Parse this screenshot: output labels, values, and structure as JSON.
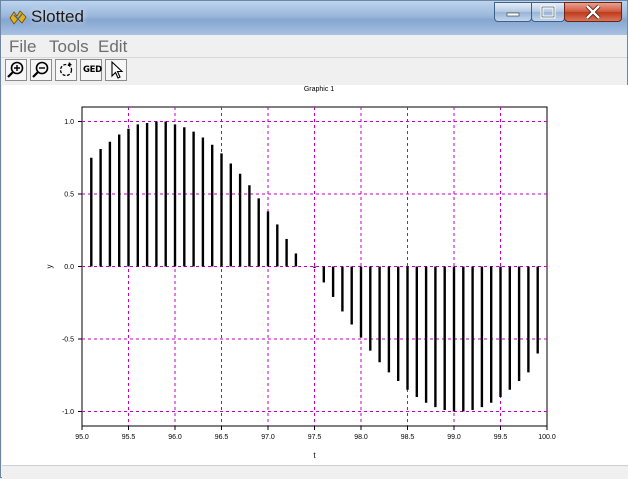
{
  "window": {
    "title": "Slotted",
    "controls": [
      "minimize",
      "maximize",
      "close"
    ],
    "icon": "scilab-icon"
  },
  "menu": [
    "File",
    "Tools",
    "Edit"
  ],
  "toolbar": {
    "buttons": [
      {
        "name": "zoom-in",
        "icon": "zoom-in-icon"
      },
      {
        "name": "zoom-out",
        "icon": "zoom-out-icon"
      },
      {
        "name": "rotate",
        "icon": "rotate-icon"
      },
      {
        "name": "ged",
        "label": "GED"
      },
      {
        "name": "pointer",
        "icon": "pointer-icon"
      }
    ]
  },
  "chart_data": {
    "type": "bar",
    "style": "stem",
    "title": "Graphic 1",
    "xlabel": "t",
    "ylabel": "y",
    "xlim": [
      95.0,
      100.0
    ],
    "ylim": [
      -1.1,
      1.1
    ],
    "xticks": [
      "95.0",
      "95.5",
      "96.0",
      "96.5",
      "97.0",
      "97.5",
      "98.0",
      "98.5",
      "99.0",
      "99.5",
      "100.0"
    ],
    "yticks": [
      "-1.0",
      "-0.5",
      "0.0",
      "0.5",
      "1.0"
    ],
    "grid": true,
    "grid_color": "#c000c0",
    "stem_color": "#000000",
    "x": [
      95.1,
      95.2,
      95.3,
      95.4,
      95.5,
      95.6,
      95.7,
      95.8,
      95.9,
      96.0,
      96.1,
      96.2,
      96.3,
      96.4,
      96.5,
      96.6,
      96.7,
      96.8,
      96.9,
      97.0,
      97.1,
      97.2,
      97.3,
      97.4,
      97.5,
      97.6,
      97.7,
      97.8,
      97.9,
      98.0,
      98.1,
      98.2,
      98.3,
      98.4,
      98.5,
      98.6,
      98.7,
      98.8,
      98.9,
      99.0,
      99.1,
      99.2,
      99.3,
      99.4,
      99.5,
      99.6,
      99.7,
      99.8,
      99.9
    ],
    "y": [
      0.75,
      0.81,
      0.86,
      0.91,
      0.95,
      0.98,
      0.99,
      1.0,
      1.0,
      0.98,
      0.96,
      0.93,
      0.89,
      0.84,
      0.78,
      0.71,
      0.64,
      0.56,
      0.47,
      0.38,
      0.29,
      0.19,
      0.09,
      0.0,
      -0.01,
      -0.11,
      -0.21,
      -0.31,
      -0.4,
      -0.49,
      -0.58,
      -0.66,
      -0.73,
      -0.79,
      -0.85,
      -0.9,
      -0.94,
      -0.97,
      -0.99,
      -1.0,
      -1.0,
      -0.99,
      -0.97,
      -0.94,
      -0.9,
      -0.85,
      -0.79,
      -0.73,
      -0.6
    ]
  }
}
